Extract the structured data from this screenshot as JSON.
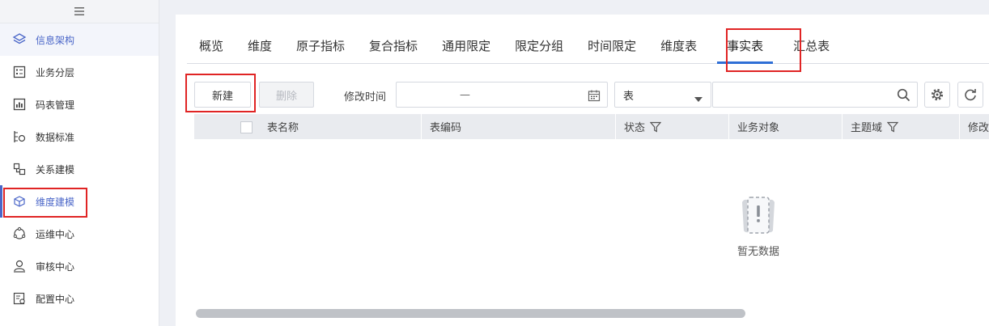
{
  "sidebar": {
    "collapse_icon": "hamburger-icon",
    "items": [
      {
        "label": "信息架构",
        "icon": "layers-icon"
      },
      {
        "label": "业务分层",
        "icon": "list-book-icon"
      },
      {
        "label": "码表管理",
        "icon": "bar-chart-icon"
      },
      {
        "label": "数据标准",
        "icon": "standard-icon"
      },
      {
        "label": "关系建模",
        "icon": "relation-icon"
      },
      {
        "label": "维度建模",
        "icon": "cube-icon"
      },
      {
        "label": "运维中心",
        "icon": "ops-icon"
      },
      {
        "label": "审核中心",
        "icon": "user-icon"
      },
      {
        "label": "配置中心",
        "icon": "config-icon"
      }
    ]
  },
  "tabs": [
    "概览",
    "维度",
    "原子指标",
    "复合指标",
    "通用限定",
    "限定分组",
    "时间限定",
    "维度表",
    "事实表",
    "汇总表"
  ],
  "active_tab": "事实表",
  "toolbar": {
    "new_label": "新建",
    "delete_label": "删除",
    "modify_time_label": "修改时间",
    "date_separator": "—",
    "type_select_value": "表",
    "search_placeholder": ""
  },
  "table": {
    "columns": [
      "表名称",
      "表编码",
      "状态",
      "业务对象",
      "主题域",
      "修改"
    ]
  },
  "empty": {
    "text": "暂无数据"
  },
  "colors": {
    "accent": "#2f6fd6",
    "sidebar_active": "#4a66c8",
    "highlight": "#e02424"
  }
}
